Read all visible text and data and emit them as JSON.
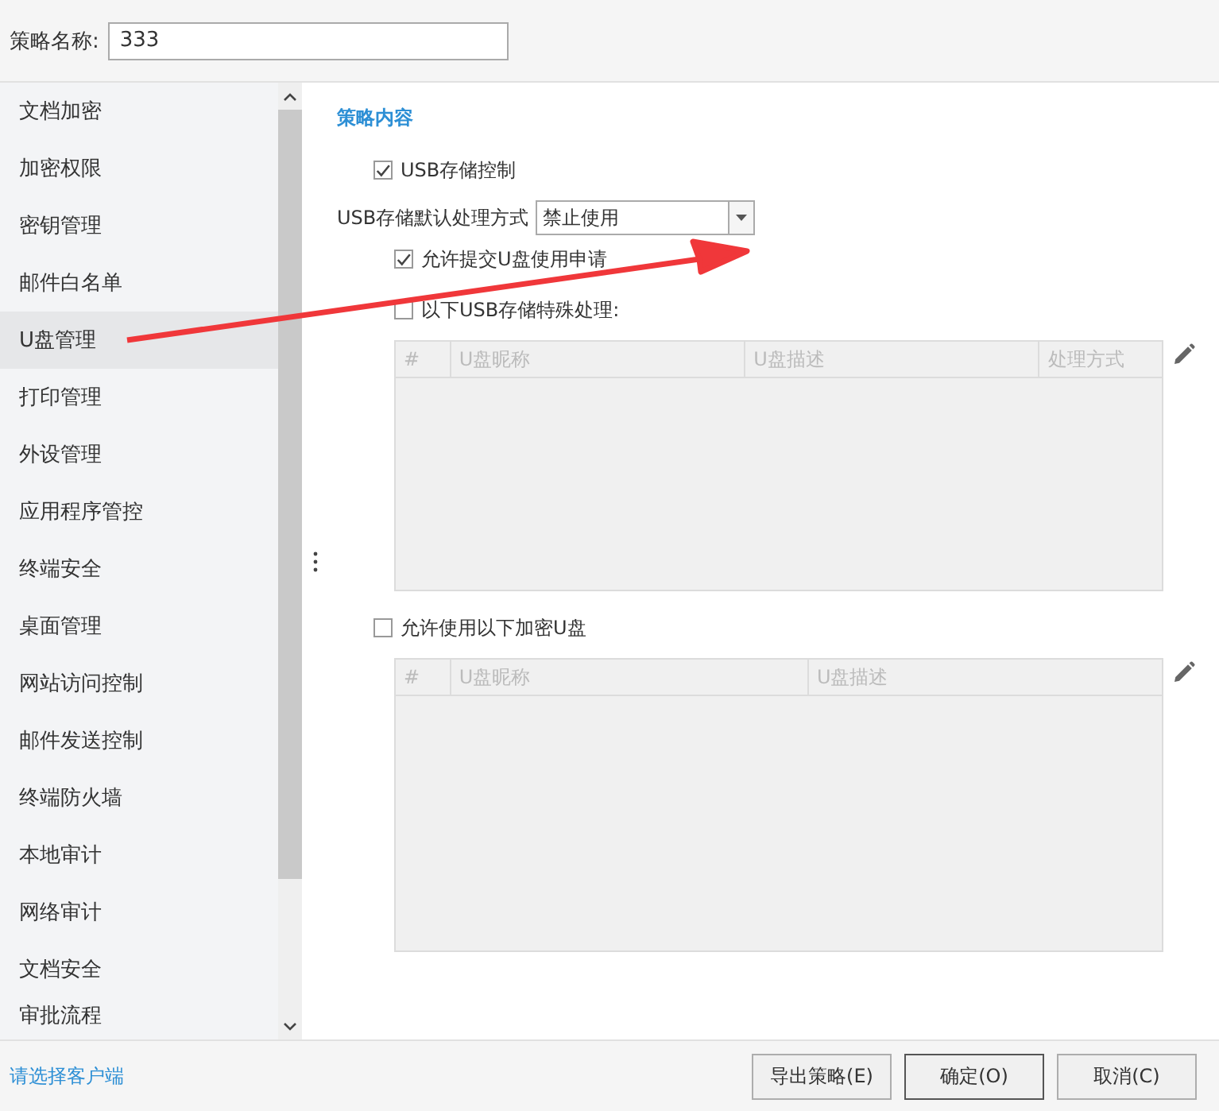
{
  "policy_name": {
    "label": "策略名称:",
    "value": "333"
  },
  "sidebar": {
    "items": [
      {
        "label": "文档加密",
        "selected": false
      },
      {
        "label": "加密权限",
        "selected": false
      },
      {
        "label": "密钥管理",
        "selected": false
      },
      {
        "label": "邮件白名单",
        "selected": false
      },
      {
        "label": "U盘管理",
        "selected": true
      },
      {
        "label": "打印管理",
        "selected": false
      },
      {
        "label": "外设管理",
        "selected": false
      },
      {
        "label": "应用程序管控",
        "selected": false
      },
      {
        "label": "终端安全",
        "selected": false
      },
      {
        "label": "桌面管理",
        "selected": false
      },
      {
        "label": "网站访问控制",
        "selected": false
      },
      {
        "label": "邮件发送控制",
        "selected": false
      },
      {
        "label": "终端防火墙",
        "selected": false
      },
      {
        "label": "本地审计",
        "selected": false
      },
      {
        "label": "网络审计",
        "selected": false
      },
      {
        "label": "文档安全",
        "selected": false
      },
      {
        "label": "审批流程",
        "selected": false
      }
    ]
  },
  "content": {
    "section_title": "策略内容",
    "usb_control": {
      "label": "USB存储控制",
      "checked": true
    },
    "default_mode": {
      "label": "USB存储默认处理方式",
      "value": "禁止使用"
    },
    "allow_request": {
      "label": "允许提交U盘使用申请",
      "checked": true
    },
    "special": {
      "label": "以下USB存储特殊处理:",
      "checked": false
    },
    "special_table": {
      "columns": [
        "#",
        "U盘昵称",
        "U盘描述",
        "处理方式"
      ]
    },
    "encrypted": {
      "label": "允许使用以下加密U盘",
      "checked": false
    },
    "encrypted_table": {
      "columns": [
        "#",
        "U盘昵称",
        "U盘描述"
      ]
    }
  },
  "footer": {
    "link": "请选择客户端",
    "buttons": [
      "导出策略(E)",
      "确定(O)",
      "取消(C)"
    ]
  }
}
